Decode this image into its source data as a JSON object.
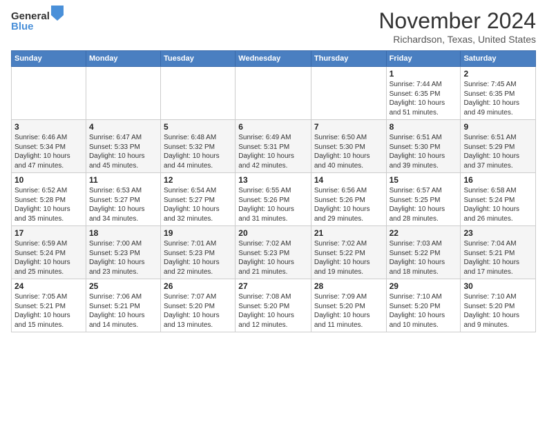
{
  "header": {
    "logo_line1": "General",
    "logo_line2": "Blue",
    "month_title": "November 2024",
    "location": "Richardson, Texas, United States"
  },
  "calendar": {
    "days_of_week": [
      "Sunday",
      "Monday",
      "Tuesday",
      "Wednesday",
      "Thursday",
      "Friday",
      "Saturday"
    ],
    "weeks": [
      [
        {
          "day": "",
          "info": ""
        },
        {
          "day": "",
          "info": ""
        },
        {
          "day": "",
          "info": ""
        },
        {
          "day": "",
          "info": ""
        },
        {
          "day": "",
          "info": ""
        },
        {
          "day": "1",
          "info": "Sunrise: 7:44 AM\nSunset: 6:35 PM\nDaylight: 10 hours\nand 51 minutes."
        },
        {
          "day": "2",
          "info": "Sunrise: 7:45 AM\nSunset: 6:35 PM\nDaylight: 10 hours\nand 49 minutes."
        }
      ],
      [
        {
          "day": "3",
          "info": "Sunrise: 6:46 AM\nSunset: 5:34 PM\nDaylight: 10 hours\nand 47 minutes."
        },
        {
          "day": "4",
          "info": "Sunrise: 6:47 AM\nSunset: 5:33 PM\nDaylight: 10 hours\nand 45 minutes."
        },
        {
          "day": "5",
          "info": "Sunrise: 6:48 AM\nSunset: 5:32 PM\nDaylight: 10 hours\nand 44 minutes."
        },
        {
          "day": "6",
          "info": "Sunrise: 6:49 AM\nSunset: 5:31 PM\nDaylight: 10 hours\nand 42 minutes."
        },
        {
          "day": "7",
          "info": "Sunrise: 6:50 AM\nSunset: 5:30 PM\nDaylight: 10 hours\nand 40 minutes."
        },
        {
          "day": "8",
          "info": "Sunrise: 6:51 AM\nSunset: 5:30 PM\nDaylight: 10 hours\nand 39 minutes."
        },
        {
          "day": "9",
          "info": "Sunrise: 6:51 AM\nSunset: 5:29 PM\nDaylight: 10 hours\nand 37 minutes."
        }
      ],
      [
        {
          "day": "10",
          "info": "Sunrise: 6:52 AM\nSunset: 5:28 PM\nDaylight: 10 hours\nand 35 minutes."
        },
        {
          "day": "11",
          "info": "Sunrise: 6:53 AM\nSunset: 5:27 PM\nDaylight: 10 hours\nand 34 minutes."
        },
        {
          "day": "12",
          "info": "Sunrise: 6:54 AM\nSunset: 5:27 PM\nDaylight: 10 hours\nand 32 minutes."
        },
        {
          "day": "13",
          "info": "Sunrise: 6:55 AM\nSunset: 5:26 PM\nDaylight: 10 hours\nand 31 minutes."
        },
        {
          "day": "14",
          "info": "Sunrise: 6:56 AM\nSunset: 5:26 PM\nDaylight: 10 hours\nand 29 minutes."
        },
        {
          "day": "15",
          "info": "Sunrise: 6:57 AM\nSunset: 5:25 PM\nDaylight: 10 hours\nand 28 minutes."
        },
        {
          "day": "16",
          "info": "Sunrise: 6:58 AM\nSunset: 5:24 PM\nDaylight: 10 hours\nand 26 minutes."
        }
      ],
      [
        {
          "day": "17",
          "info": "Sunrise: 6:59 AM\nSunset: 5:24 PM\nDaylight: 10 hours\nand 25 minutes."
        },
        {
          "day": "18",
          "info": "Sunrise: 7:00 AM\nSunset: 5:23 PM\nDaylight: 10 hours\nand 23 minutes."
        },
        {
          "day": "19",
          "info": "Sunrise: 7:01 AM\nSunset: 5:23 PM\nDaylight: 10 hours\nand 22 minutes."
        },
        {
          "day": "20",
          "info": "Sunrise: 7:02 AM\nSunset: 5:23 PM\nDaylight: 10 hours\nand 21 minutes."
        },
        {
          "day": "21",
          "info": "Sunrise: 7:02 AM\nSunset: 5:22 PM\nDaylight: 10 hours\nand 19 minutes."
        },
        {
          "day": "22",
          "info": "Sunrise: 7:03 AM\nSunset: 5:22 PM\nDaylight: 10 hours\nand 18 minutes."
        },
        {
          "day": "23",
          "info": "Sunrise: 7:04 AM\nSunset: 5:21 PM\nDaylight: 10 hours\nand 17 minutes."
        }
      ],
      [
        {
          "day": "24",
          "info": "Sunrise: 7:05 AM\nSunset: 5:21 PM\nDaylight: 10 hours\nand 15 minutes."
        },
        {
          "day": "25",
          "info": "Sunrise: 7:06 AM\nSunset: 5:21 PM\nDaylight: 10 hours\nand 14 minutes."
        },
        {
          "day": "26",
          "info": "Sunrise: 7:07 AM\nSunset: 5:20 PM\nDaylight: 10 hours\nand 13 minutes."
        },
        {
          "day": "27",
          "info": "Sunrise: 7:08 AM\nSunset: 5:20 PM\nDaylight: 10 hours\nand 12 minutes."
        },
        {
          "day": "28",
          "info": "Sunrise: 7:09 AM\nSunset: 5:20 PM\nDaylight: 10 hours\nand 11 minutes."
        },
        {
          "day": "29",
          "info": "Sunrise: 7:10 AM\nSunset: 5:20 PM\nDaylight: 10 hours\nand 10 minutes."
        },
        {
          "day": "30",
          "info": "Sunrise: 7:10 AM\nSunset: 5:20 PM\nDaylight: 10 hours\nand 9 minutes."
        }
      ]
    ]
  }
}
